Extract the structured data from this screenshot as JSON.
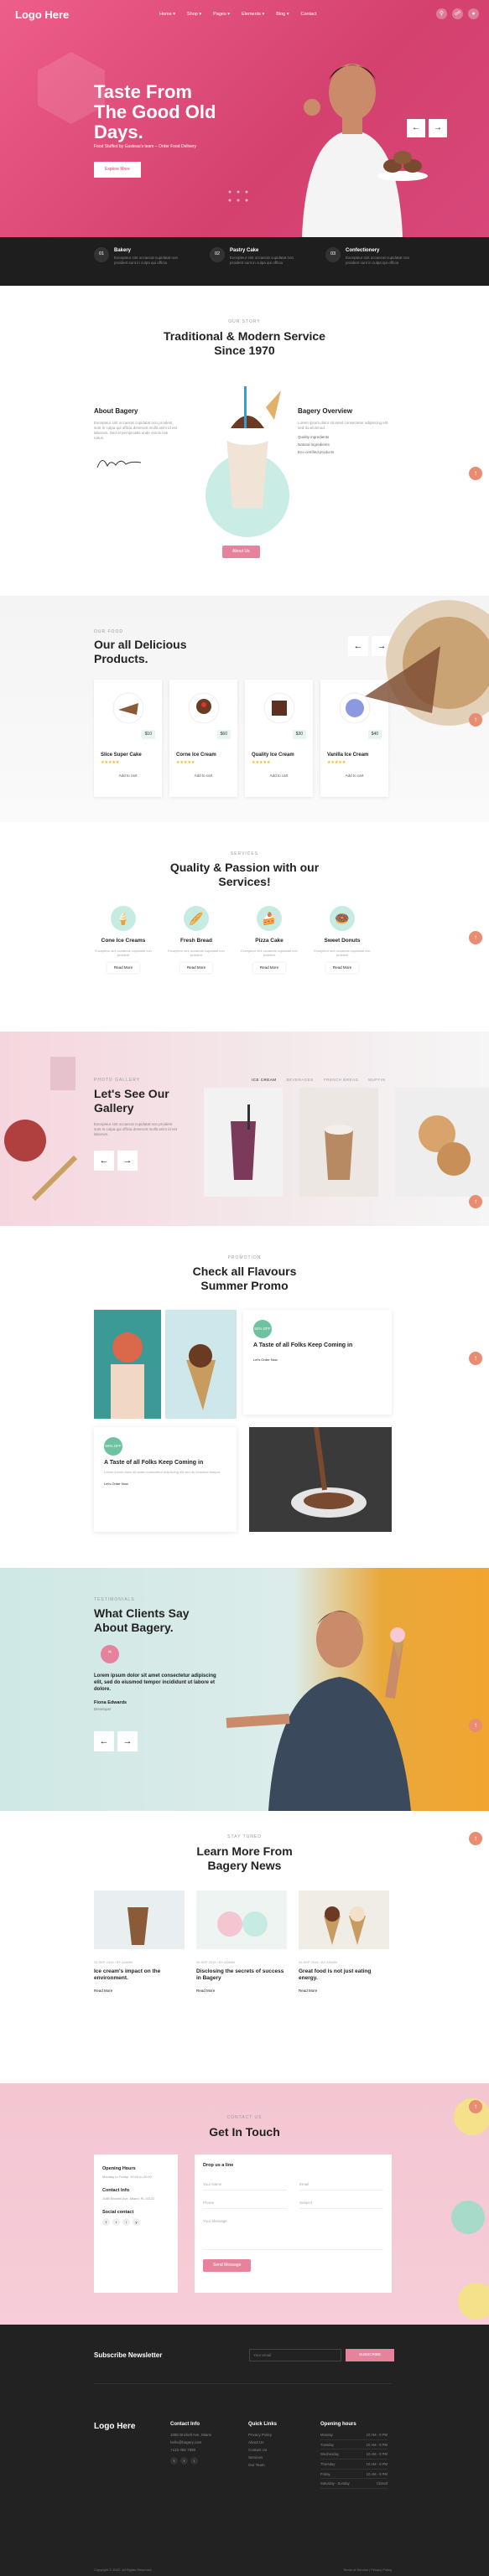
{
  "header": {
    "logo": "Logo Here",
    "menu": [
      "Home ▾",
      "Shop ▾",
      "Pages ▾",
      "Elements ▾",
      "Blog ▾",
      "Contact"
    ],
    "icons": [
      "search-icon",
      "cart-icon",
      "user-icon"
    ]
  },
  "hero": {
    "title": "Taste From The Good Old Days.",
    "subtitle": "Food Stuffed by Gusteau's team – Order Food Delivery",
    "button": "Explore More",
    "prev": "←",
    "next": "→"
  },
  "features": [
    {
      "num": "01",
      "title": "Bakery",
      "text": "Excepteur sint occaecat cupidatat non proident sunt in culpa qui officia"
    },
    {
      "num": "02",
      "title": "Pastry Cake",
      "text": "Excepteur sint occaecat cupidatat non proident sunt in culpa qui officia"
    },
    {
      "num": "03",
      "title": "Confectionery",
      "text": "Excepteur sint occaecat cupidatat non proident sunt in culpa qui officia"
    }
  ],
  "story": {
    "eyebrow": "Our Story",
    "title": "Traditional & Modern Service Since 1970",
    "about_title": "About Bagery",
    "about_text": "Excepteur sint occaecat cupidatat non proident, sunt in culpa qui officia deserunt mollit anim id est laborum. Sed ut perspiciatis unde omnis iste natus.",
    "overview_title": "Bagery Overview",
    "overview_text": "Lorem ipsum dolor sit amet consectetur adipiscing elit sed do eiusmod.",
    "overview_items": [
      "Quality ingredients",
      "Natural ingredients",
      "Eco certified products"
    ],
    "button": "About Us"
  },
  "products": {
    "eyebrow": "Our Food",
    "title": "Our all Delicious Products.",
    "items": [
      {
        "name": "Slice Super Cake",
        "price": "$10",
        "stars": "★★★★★",
        "add": "Add to cart"
      },
      {
        "name": "Corne Ice Cream",
        "price": "$60",
        "stars": "★★★★★",
        "add": "Add to cart"
      },
      {
        "name": "Quality Ice Cream",
        "price": "$30",
        "stars": "★★★★★",
        "add": "Add to cart"
      },
      {
        "name": "Vanilla Ice Cream",
        "price": "$40",
        "stars": "★★★★★",
        "add": "Add to cart"
      }
    ]
  },
  "services": {
    "eyebrow": "Services",
    "title": "Quality & Passion with our Services!",
    "items": [
      {
        "name": "Cone Ice Creams",
        "text": "Excepteur sint occaecat cupidatat non proident",
        "more": "Read More"
      },
      {
        "name": "Fresh Bread",
        "text": "Excepteur sint occaecat cupidatat non proident",
        "more": "Read More"
      },
      {
        "name": "Pizza Cake",
        "text": "Excepteur sint occaecat cupidatat non proident",
        "more": "Read More"
      },
      {
        "name": "Sweet Donuts",
        "text": "Excepteur sint occaecat cupidatat non proident",
        "more": "Read More"
      }
    ]
  },
  "gallery": {
    "eyebrow": "Photo Gallery",
    "title": "Let's See Our Gallery",
    "text": "Excepteur sint occaecat cupidatat non proident sunt in culpa qui officia deserunt mollit anim id est laborum.",
    "tabs": [
      "ICE CREAM",
      "BEVERAGES",
      "FRENCH BREAD",
      "MUFFIN"
    ]
  },
  "promo": {
    "eyebrow": "Promotion",
    "title": "Check all Flavours Summer Promo",
    "card1_badge": "50% OFF",
    "card1_title": "A Taste of all Folks Keep Coming in",
    "card1_link": "Let's Order Now",
    "card2_badge": "50% OFF",
    "card2_title": "A Taste of all Folks Keep Coming in",
    "card2_text": "Lorem ipsum dolor sit amet consectetur adipiscing elit sed do eiusmod tempor.",
    "card2_link": "Let's Order Now"
  },
  "testimonials": {
    "eyebrow": "Testimonials",
    "title": "What Clients Say About Bagery.",
    "quote": "Lorem ipsum dolor sit amet consectetur adipiscing elit, sed do eiusmod tempor incididunt ut labore et dolore.",
    "name": "Fiona Edwards",
    "role": "Developer"
  },
  "news": {
    "eyebrow": "Stay Tuned",
    "title": "Learn More From Bagery News",
    "items": [
      {
        "meta": "26 SEP 2019 / BY ADMIN",
        "title": "Ice cream's impact on the environment.",
        "more": "Read More"
      },
      {
        "meta": "26 SEP 2019 / BY ADMIN",
        "title": "Disclosing the secrets of success in Bagery",
        "more": "Read More"
      },
      {
        "meta": "26 SEP 2019 / BY ADMIN",
        "title": "Great food is not just eating energy.",
        "more": "Read More"
      }
    ]
  },
  "contact": {
    "eyebrow": "Contact Us",
    "title": "Get In Touch",
    "hours_title": "Opening Hours",
    "hours_text": "Monday to Friday: 10:00 to 20:00",
    "info_title": "Contact Info",
    "info_text": "1080 Brickell Ave, Miami, FL 33131",
    "social_title": "Social contact",
    "form_title": "Drop us a line",
    "name_ph": "Your Name",
    "email_ph": "Email",
    "phone_ph": "Phone",
    "subject_ph": "Subject",
    "message_ph": "Your Message",
    "submit": "Send Message"
  },
  "footer": {
    "newsletter": "Subscribe Newsletter",
    "email_ph": "Your email",
    "subscribe": "SUBSCRIBE",
    "logo": "Logo Here",
    "contact_title": "Contact Info",
    "contact_lines": [
      "1080 Brickell Ave, Miami",
      "hello@bagery.com",
      "+123 456 7890"
    ],
    "links_title": "Quick Links",
    "links": [
      "Privacy Policy",
      "About Us",
      "Contact Us",
      "Services",
      "Our Team"
    ],
    "hours_title": "Opening hours",
    "hours": [
      [
        "Monday",
        "10 AM - 8 PM"
      ],
      [
        "Tuesday",
        "10 AM - 8 PM"
      ],
      [
        "Wednesday",
        "10 AM - 8 PM"
      ],
      [
        "Thursday",
        "10 AM - 8 PM"
      ],
      [
        "Friday",
        "10 AM - 8 PM"
      ],
      [
        "Saturday - Sunday",
        "Closed"
      ]
    ],
    "copyright": "Copyright © 2022. All Rights Reserved.",
    "legal": "Terms of Service  |  Privacy Policy"
  }
}
